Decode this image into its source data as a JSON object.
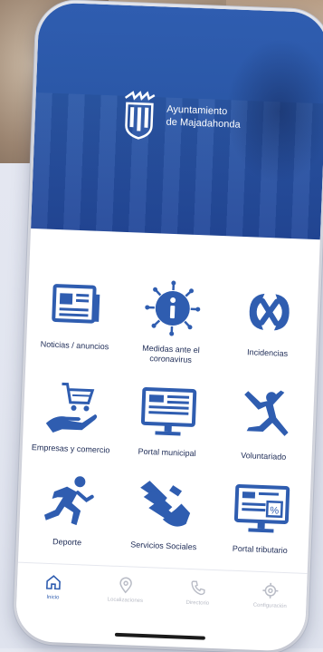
{
  "app": {
    "org_line1": "Ayuntamiento",
    "org_line2": "de Majadahonda"
  },
  "colors": {
    "brand_blue": "#2f5db0",
    "label": "#1c2a55",
    "inactive_tab": "#b9bcc6"
  },
  "tiles": [
    {
      "label": "Noticias / anuncios",
      "icon": "newspaper-icon"
    },
    {
      "label": "Medidas ante el coronavirus",
      "icon": "coronavirus-info-icon"
    },
    {
      "label": "Incidencias",
      "icon": "incidencias-icon"
    },
    {
      "label": "Empresas y comercio",
      "icon": "shopping-cart-hand-icon"
    },
    {
      "label": "Portal municipal",
      "icon": "monitor-icon"
    },
    {
      "label": "Voluntariado",
      "icon": "volunteer-icon"
    },
    {
      "label": "Deporte",
      "icon": "runner-icon"
    },
    {
      "label": "Servicios Sociales",
      "icon": "helping-hands-icon"
    },
    {
      "label": "Portal tributario",
      "icon": "tax-monitor-icon"
    }
  ],
  "tabbar": {
    "items": [
      {
        "label": "Inicio",
        "icon": "home-icon",
        "active": true
      },
      {
        "label": "Localizaciones",
        "icon": "location-pin-icon",
        "active": false
      },
      {
        "label": "Directorio",
        "icon": "phone-icon",
        "active": false
      },
      {
        "label": "Configuración",
        "icon": "gear-icon",
        "active": false
      }
    ]
  }
}
